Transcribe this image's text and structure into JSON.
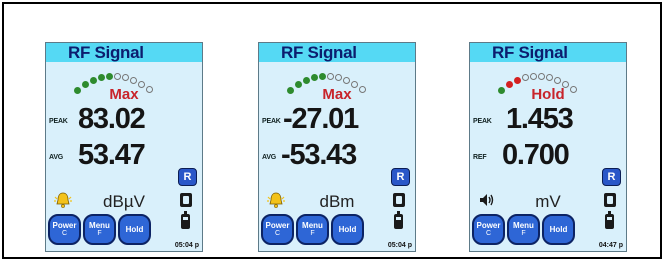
{
  "screens": [
    {
      "title": "RF Signal",
      "dots": [
        "green",
        "green",
        "green",
        "green",
        "green",
        "empty",
        "empty",
        "empty",
        "empty",
        "empty"
      ],
      "mode": "Max",
      "row1_tag": "PEAK",
      "row1_value": "83.02",
      "row2_tag": "AVG",
      "row2_value": "53.47",
      "unit": "dBµV",
      "status_icon": "bell-alarm-icon",
      "r_button": "R",
      "buttons": [
        {
          "l1": "Power",
          "l2": "C"
        },
        {
          "l1": "Menu",
          "l2": "F"
        },
        {
          "l1": "Hold",
          "l2": ""
        }
      ],
      "time": "05:04 p"
    },
    {
      "title": "RF Signal",
      "dots": [
        "green",
        "green",
        "green",
        "green",
        "green",
        "empty",
        "empty",
        "empty",
        "empty",
        "empty"
      ],
      "mode": "Max",
      "row1_tag": "PEAK",
      "row1_value": "-27.01",
      "row2_tag": "AVG",
      "row2_value": "-53.43",
      "unit": "dBm",
      "status_icon": "bell-alarm-icon",
      "r_button": "R",
      "buttons": [
        {
          "l1": "Power",
          "l2": "C"
        },
        {
          "l1": "Menu",
          "l2": "F"
        },
        {
          "l1": "Hold",
          "l2": ""
        }
      ],
      "time": "05:04 p"
    },
    {
      "title": "RF Signal",
      "dots": [
        "green",
        "red",
        "red",
        "empty",
        "empty",
        "empty",
        "empty",
        "empty",
        "empty",
        "empty"
      ],
      "mode": "Hold",
      "row1_tag": "PEAK",
      "row1_value": "1.453",
      "row2_tag": "REF",
      "row2_value": "0.700",
      "unit": "mV",
      "status_icon": "speaker-icon",
      "r_button": "R",
      "buttons": [
        {
          "l1": "Power",
          "l2": "C"
        },
        {
          "l1": "Menu",
          "l2": "F"
        },
        {
          "l1": "Hold",
          "l2": ""
        }
      ],
      "time": "04:47 p"
    }
  ],
  "colors": {
    "green": "#2e8b2e",
    "red": "#d42020",
    "screen_bg": "#d9f0fb",
    "title_bg": "#55d9f4",
    "button_blue": "#2e66d6"
  }
}
